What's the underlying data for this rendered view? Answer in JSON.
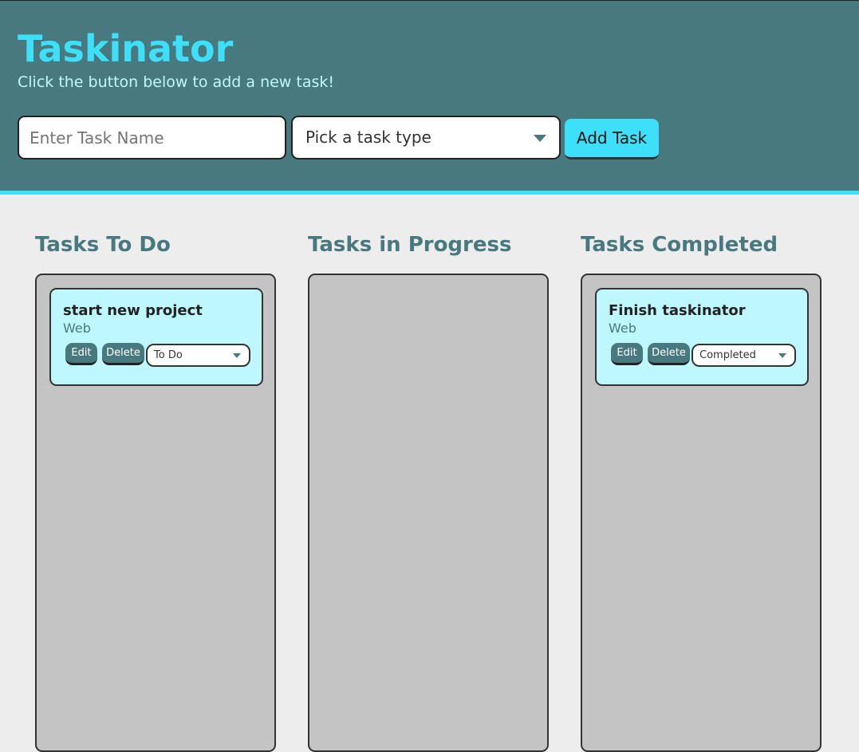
{
  "header": {
    "title": "Taskinator",
    "subtitle": "Click the button below to add a new task!"
  },
  "form": {
    "name_placeholder": "Enter Task Name",
    "type_select_value": "Pick a task type",
    "add_button_label": "Add Task"
  },
  "columns": [
    {
      "title": "Tasks To Do",
      "tasks": [
        {
          "name": "start new project",
          "type": "Web",
          "edit_label": "Edit",
          "delete_label": "Delete",
          "status": "To Do"
        }
      ]
    },
    {
      "title": "Tasks in Progress",
      "tasks": []
    },
    {
      "title": "Tasks Completed",
      "tasks": [
        {
          "name": "Finish taskinator",
          "type": "Web",
          "edit_label": "Edit",
          "delete_label": "Delete",
          "status": "Completed"
        }
      ]
    }
  ],
  "colors": {
    "header_bg": "#48797f",
    "accent": "#3de0f8",
    "card_bg": "#bff7ff",
    "list_bg": "#c4c4c4",
    "page_bg": "#ededed"
  }
}
